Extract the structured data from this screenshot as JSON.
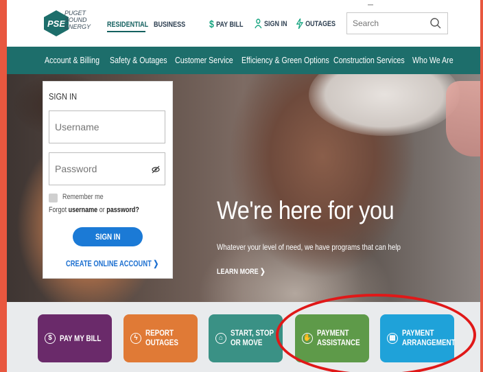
{
  "brand": {
    "logo_mark": "PSE",
    "logo_lines": [
      "PUGET",
      "SOUND",
      "ENERGY"
    ],
    "primary_color": "#1d6e6b"
  },
  "top_nav": {
    "residential": "RESIDENTIAL",
    "business": "BUSINESS"
  },
  "utility": {
    "pay_bill": "PAY BILL",
    "sign_in": "SIGN IN",
    "outages": "OUTAGES",
    "search_placeholder": "Search"
  },
  "main_nav": [
    "Account & Billing",
    "Safety & Outages",
    "Customer Service",
    "Efficiency & Green Options",
    "Construction Services",
    "Who We Are"
  ],
  "signin": {
    "title": "SIGN IN",
    "username_placeholder": "Username",
    "password_placeholder": "Password",
    "remember": "Remember me",
    "forgot_prefix": "Forgot ",
    "forgot_username": "username",
    "forgot_or": " or ",
    "forgot_password": "password?",
    "button": "SIGN IN",
    "create_account": "CREATE ONLINE ACCOUNT ❯"
  },
  "hero": {
    "title": "We're here for you",
    "subtitle": "Whatever your level of need, we have programs that can help",
    "cta": "LEARN MORE ❯"
  },
  "tiles": [
    {
      "line1": "PAY MY BILL",
      "line2": "",
      "color": "#6a2a6a",
      "icon": "dollar-icon"
    },
    {
      "line1": "REPORT",
      "line2": "OUTAGES",
      "color": "#e07a36",
      "icon": "bolt-icon"
    },
    {
      "line1": "START, STOP",
      "line2": "OR MOVE",
      "color": "#3a9185",
      "icon": "move-icon"
    },
    {
      "line1": "PAYMENT",
      "line2": "ASSISTANCE",
      "color": "#5e9a49",
      "icon": "hand-icon"
    },
    {
      "line1": "PAYMENT",
      "line2": "ARRANGEMENT",
      "color": "#1fa2d9",
      "icon": "calendar-icon"
    }
  ],
  "annotation_color": "#e01818"
}
